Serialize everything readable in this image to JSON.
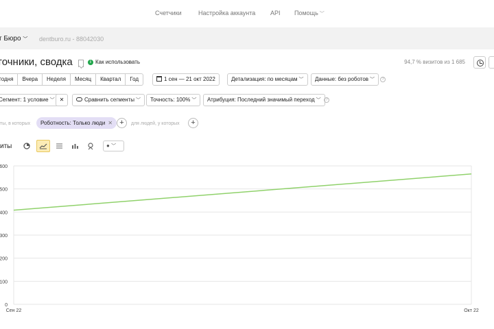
{
  "topnav": {
    "items": [
      "Счетчики",
      "Настройка аккаунта",
      "API",
      "Помощь"
    ]
  },
  "counter": {
    "name": "т Бюро",
    "info": "dentburo.ru - 88042030"
  },
  "header": {
    "title": "точники, сводка",
    "how_to": "Как использовать",
    "visits_pct": "94,7 % визитов из 1 685"
  },
  "period": {
    "segments": [
      "годня",
      "Вчера",
      "Неделя",
      "Месяц",
      "Квартал",
      "Год"
    ],
    "date_range": "1 сен — 21 окт 2022",
    "detail": "Детализация: по месяцам",
    "data": "Данные: без роботов"
  },
  "segments_row": {
    "segment": "Сегмент: 1 условие",
    "compare": "Сравнить сегменты",
    "accuracy": "Точность: 100%",
    "attribution": "Атрибуция: Последний значимый переход"
  },
  "filter_row": {
    "prefix": "ты, в которых",
    "chip": "Роботность: Только люди",
    "people_text": "для людей, у которых"
  },
  "chart_toolbar": {
    "label": "иты"
  },
  "colors": {
    "line": "#8fd16a",
    "chip_bg": "#e3def5",
    "active_tool": "#fcecb6"
  },
  "chart_data": {
    "type": "line",
    "x": [
      "Сен 22",
      "Окт 22"
    ],
    "series": [
      {
        "values": [
          408,
          565
        ]
      }
    ],
    "y_ticks": [
      "600",
      "500",
      "400",
      "300",
      "200",
      "100",
      "0"
    ],
    "ylim": [
      0,
      600
    ],
    "grid": true
  }
}
